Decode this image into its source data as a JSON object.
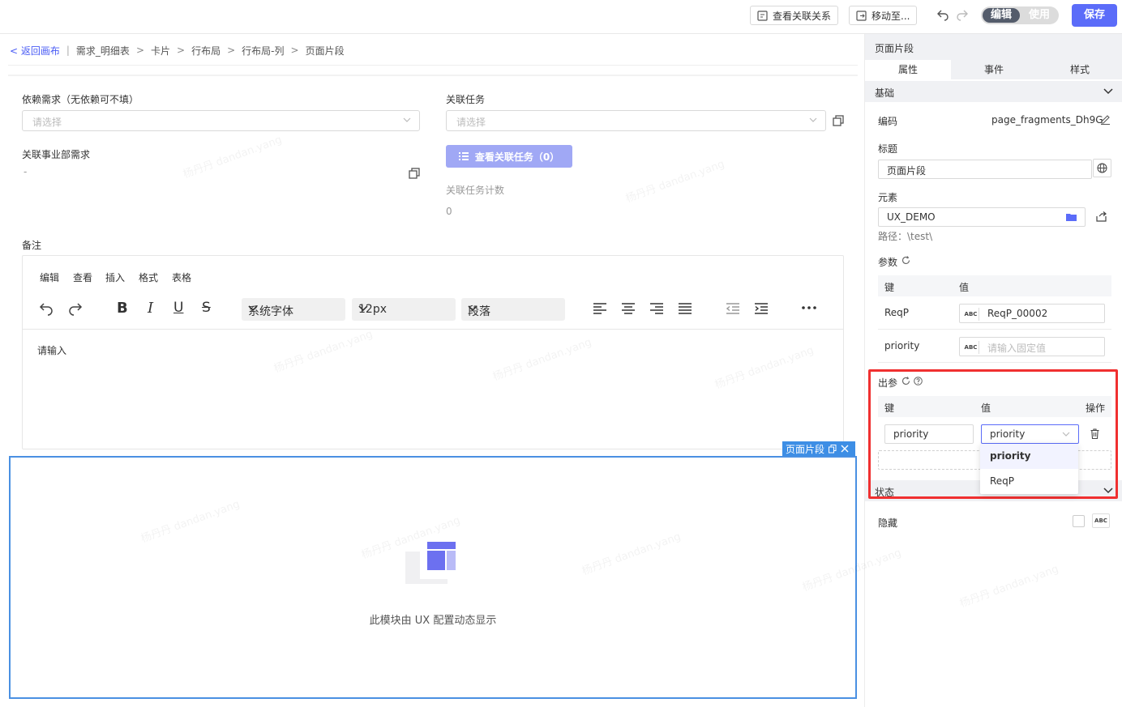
{
  "topbar": {
    "view_relations": "查看关联关系",
    "move_to": "移动至...",
    "mode_edit": "编辑",
    "mode_use": "使用",
    "save": "保存"
  },
  "breadcrumb": {
    "back": "< 返回画布",
    "items": [
      "需求_明细表",
      "卡片",
      "行布局",
      "行布局-列",
      "页面片段"
    ]
  },
  "form": {
    "depend_label": "依赖需求（无依赖可不填）",
    "depend_placeholder": "请选择",
    "related_task_label": "关联任务",
    "related_task_placeholder": "请选择",
    "dept_req_label": "关联事业部需求",
    "dept_req_value": "-",
    "view_tasks_button": "查看关联任务（0）",
    "task_count_label": "关联任务计数",
    "task_count_value": "0",
    "remark_label": "备注"
  },
  "editor": {
    "menus": [
      "编辑",
      "查看",
      "插入",
      "格式",
      "表格"
    ],
    "font_family": "系统字体",
    "font_size": "12px",
    "block_format": "段落",
    "placeholder": "请输入"
  },
  "fragment": {
    "tag_label": "页面片段",
    "message": "此模块由 UX 配置动态显示"
  },
  "panel": {
    "title": "页面片段",
    "tabs": [
      "属性",
      "事件",
      "样式"
    ],
    "basic_section": "基础",
    "code_label": "编码",
    "code_value": "page_fragments_Dh9G",
    "title_label": "标题",
    "title_value": "页面片段",
    "element_label": "元素",
    "element_value": "UX_DEMO",
    "path_text": "路径：\\test\\",
    "params_label": "参数",
    "params_key_header": "键",
    "params_value_header": "值",
    "params": [
      {
        "key": "ReqP",
        "value": "ReqP_00002",
        "placeholder": ""
      },
      {
        "key": "priority",
        "value": "",
        "placeholder": "请输入固定值"
      }
    ],
    "out_params_label": "出参",
    "out_key_header": "键",
    "out_value_header": "值",
    "out_action_header": "操作",
    "out_row_key": "priority",
    "out_row_value": "priority",
    "dropdown_options": [
      "priority",
      "ReqP"
    ],
    "status_section": "状态",
    "hidden_label": "隐藏",
    "abc": "ABC"
  },
  "watermark": "杨丹丹 dandan.yang",
  "colors": {
    "primary": "#5b6cf9",
    "selection": "#4a90e2",
    "highlight": "#f03030"
  }
}
